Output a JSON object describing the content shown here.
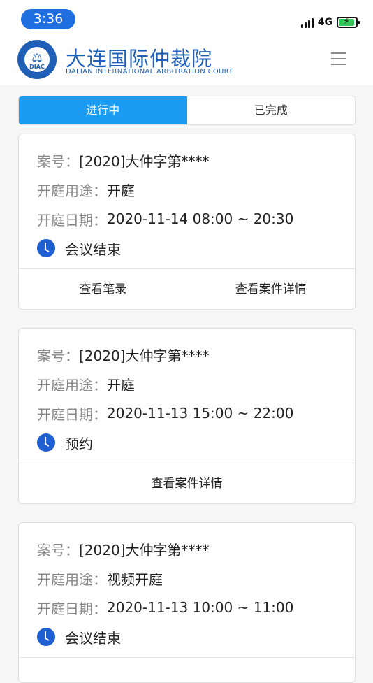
{
  "status_bar": {
    "time": "3:36",
    "network": "4G"
  },
  "header": {
    "logo_abbr": "DIAC",
    "title_cn": "大连国际仲裁院",
    "title_en": "DALIAN INTERNATIONAL ARBITRATION COURT"
  },
  "tabs": [
    {
      "label": "进行中",
      "active": true
    },
    {
      "label": "已完成",
      "active": false
    }
  ],
  "field_labels": {
    "case_no": "案号：",
    "purpose": "开庭用途：",
    "date": "开庭日期："
  },
  "cards": [
    {
      "case_no": "[2020]大仲字第****",
      "purpose": "开庭",
      "date": "2020-11-14 08:00 ~ 20:30",
      "status": "会议结束",
      "actions": [
        "查看笔录",
        "查看案件详情"
      ]
    },
    {
      "case_no": "[2020]大仲字第****",
      "purpose": "开庭",
      "date": "2020-11-13 15:00 ~ 22:00",
      "status": "预约",
      "actions": [
        "查看案件详情"
      ]
    },
    {
      "case_no": "[2020]大仲字第****",
      "purpose": "视频开庭",
      "date": "2020-11-13 10:00 ~ 11:00",
      "status": "会议结束",
      "actions": []
    }
  ],
  "colors": {
    "brand": "#1f5fb5",
    "tab_active": "#1b9cf2",
    "status_icon": "#1f5fd1"
  }
}
